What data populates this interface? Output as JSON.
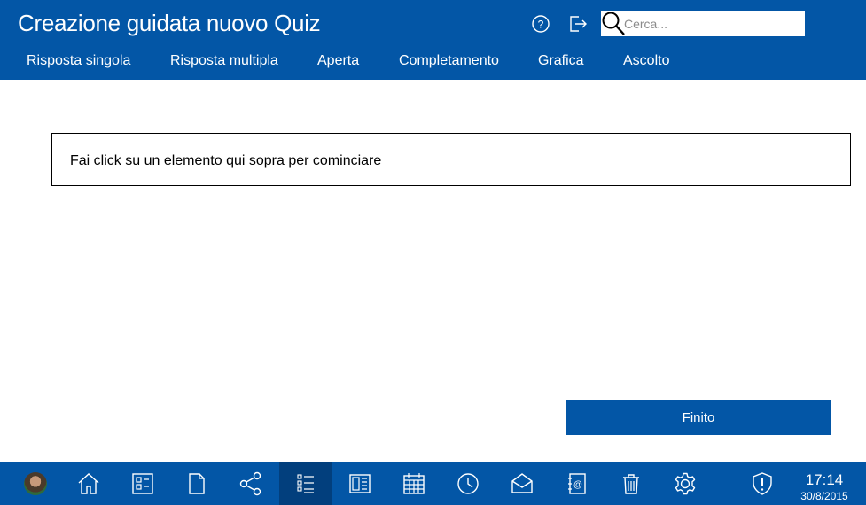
{
  "header": {
    "title": "Creazione guidata nuovo Quiz",
    "help_icon": "help-icon",
    "exit_icon": "exit-icon",
    "search": {
      "placeholder": "Cerca...",
      "value": ""
    }
  },
  "tabs": [
    {
      "label": "Risposta singola"
    },
    {
      "label": "Risposta multipla"
    },
    {
      "label": "Aperta"
    },
    {
      "label": "Completamento"
    },
    {
      "label": "Grafica"
    },
    {
      "label": "Ascolto"
    }
  ],
  "main": {
    "hint": "Fai click su un elemento qui sopra per cominciare",
    "finish_label": "Finito"
  },
  "taskbar": {
    "items": [
      "avatar",
      "home-icon",
      "dashboard-icon",
      "document-icon",
      "share-icon",
      "checklist-icon",
      "news-icon",
      "calendar-icon",
      "clock-icon",
      "mail-icon",
      "contacts-icon",
      "trash-icon",
      "settings-icon",
      "shield-alert-icon"
    ],
    "active": "checklist-icon",
    "time": "17:14",
    "date": "30/8/2015"
  },
  "colors": {
    "brand": "#0356a6",
    "active_taskbar": "#023f7d"
  }
}
